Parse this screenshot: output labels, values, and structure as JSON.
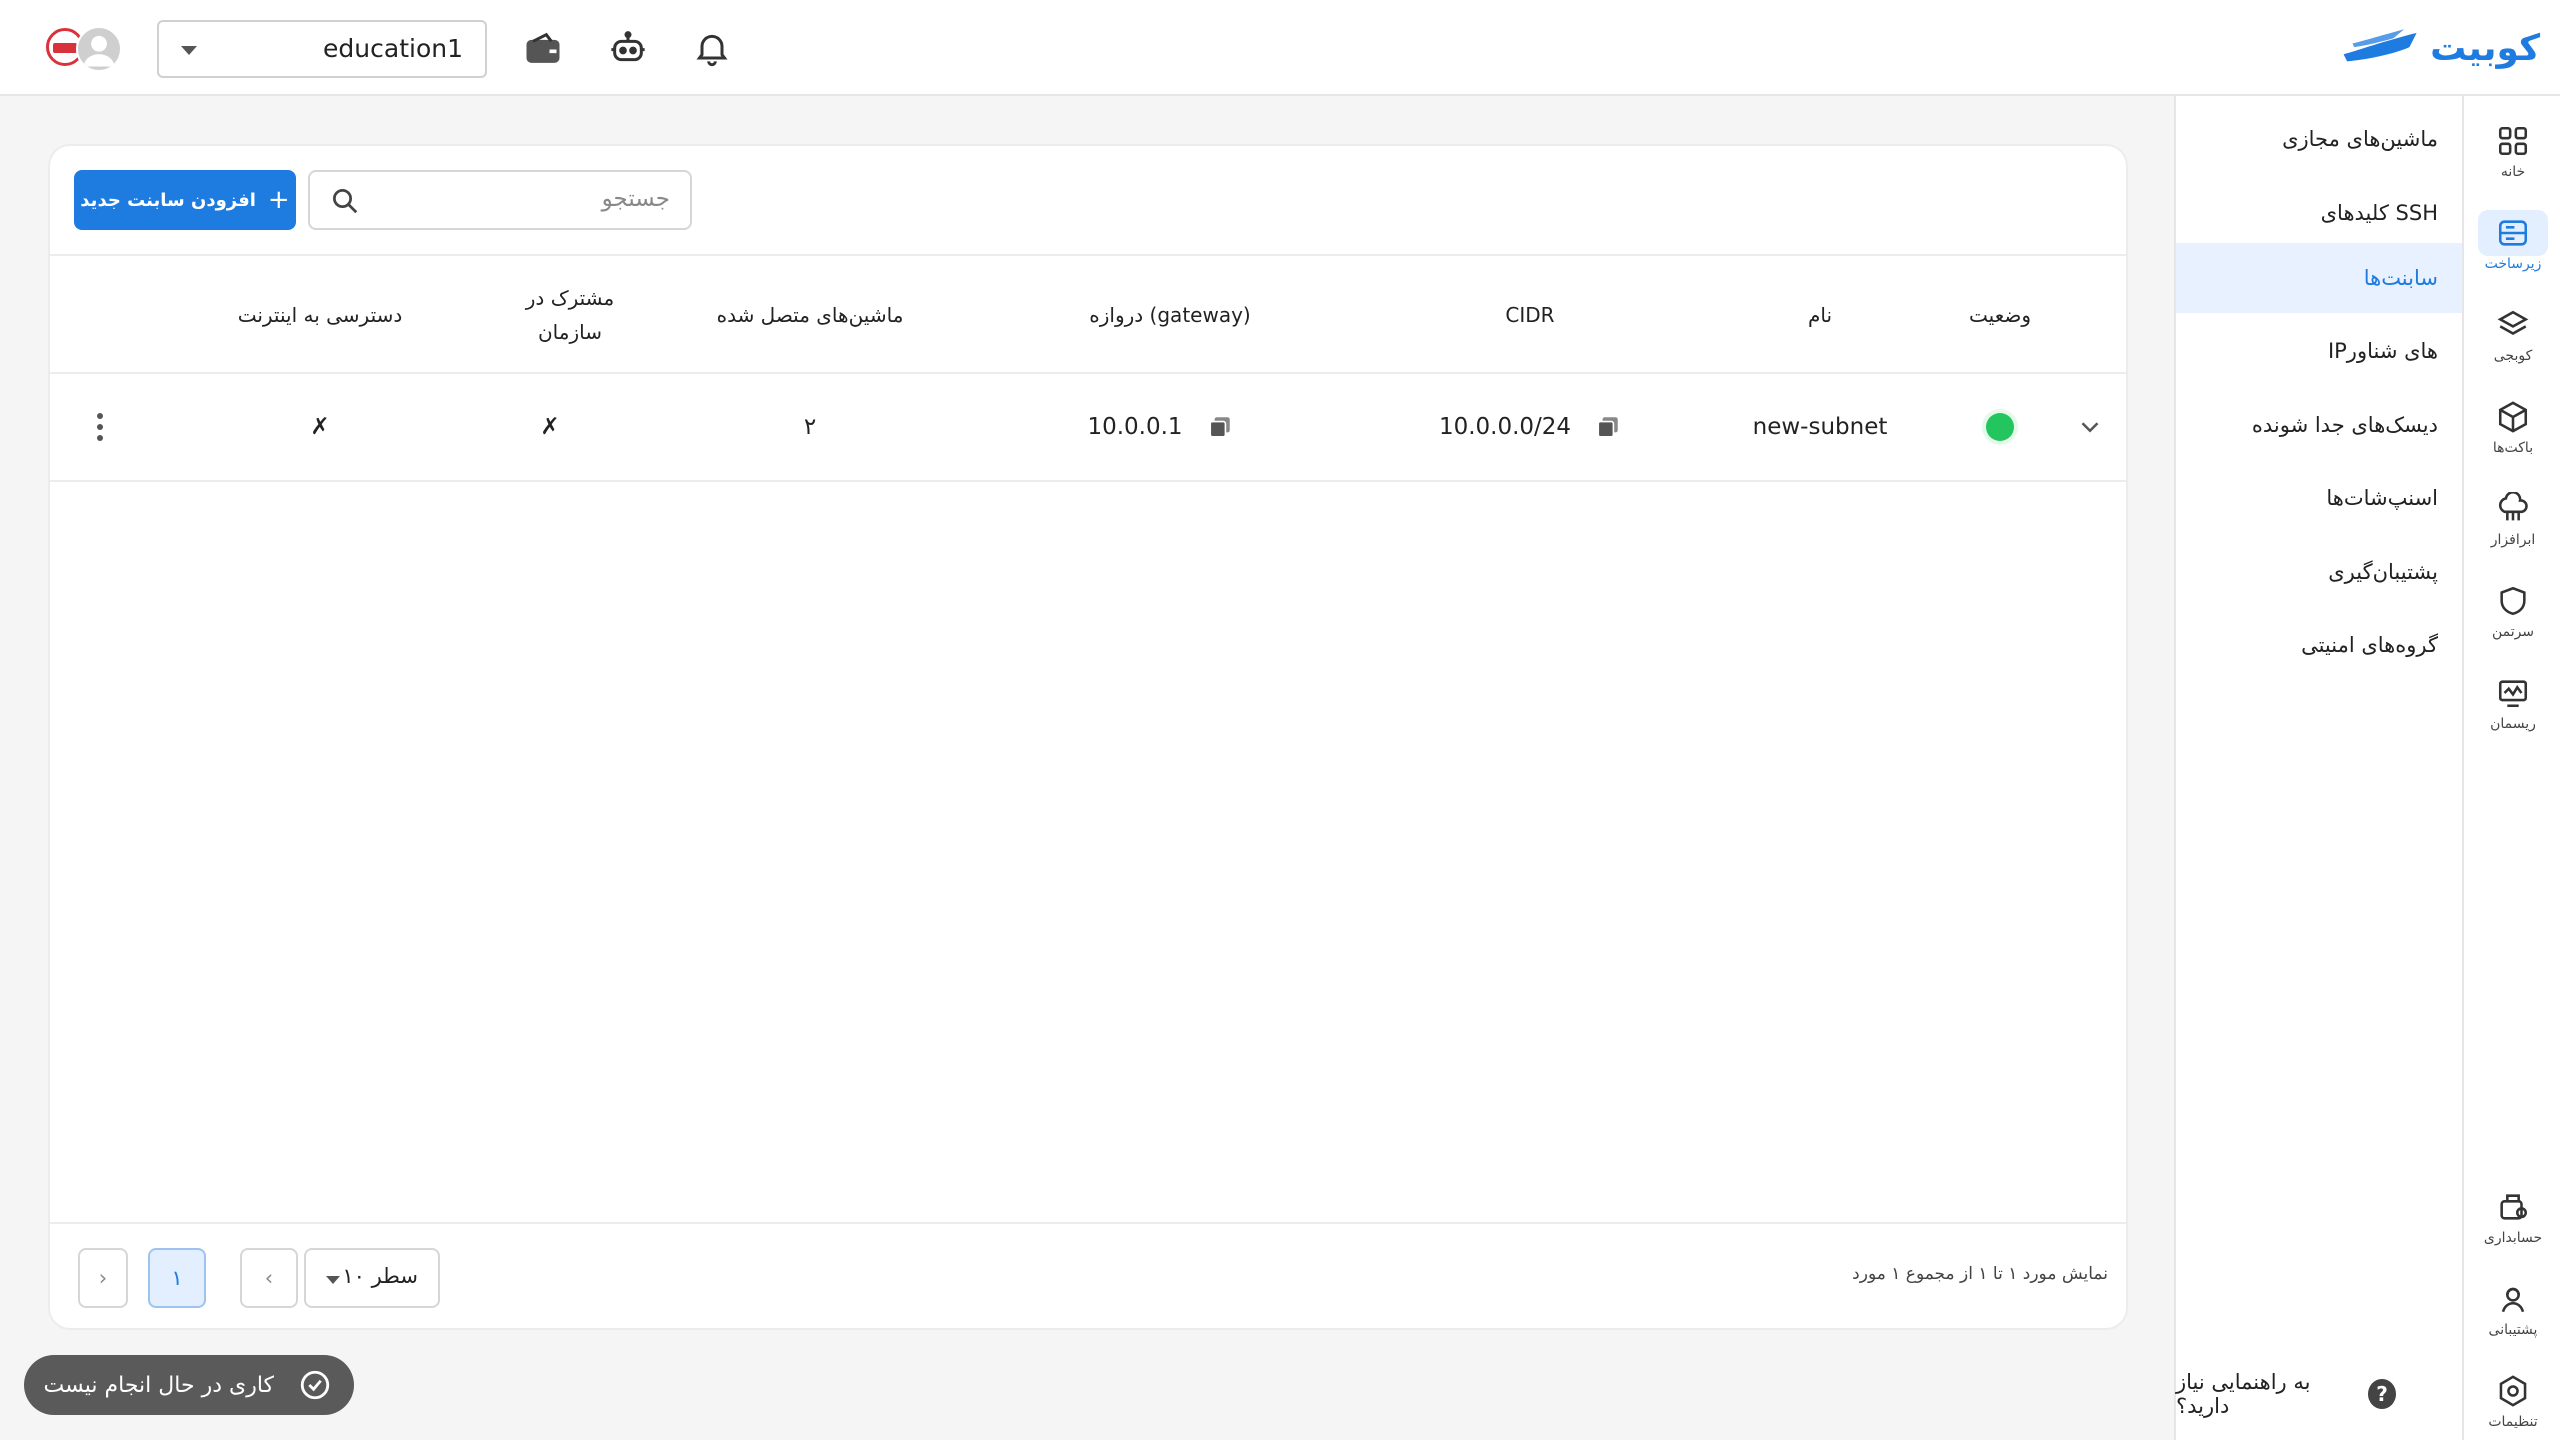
{
  "header": {
    "logo_text": "کوبیت",
    "org_selected": "education1",
    "icons": [
      "notification-bell-icon",
      "robot-icon",
      "wallet-icon"
    ]
  },
  "rail": {
    "items": [
      {
        "label": "خانه",
        "icon": "grid-icon"
      },
      {
        "label": "زیرساخت",
        "icon": "server-icon",
        "active": true
      },
      {
        "label": "کوبجی",
        "icon": "layers-icon"
      },
      {
        "label": "باکت‌ها",
        "icon": "cube-icon"
      },
      {
        "label": "ابرافزار",
        "icon": "cloud-app-icon"
      },
      {
        "label": "سرتمن",
        "icon": "shield-icon"
      },
      {
        "label": "ریسمان",
        "icon": "monitor-icon"
      },
      {
        "label": "حسابداری",
        "icon": "accounting-icon"
      },
      {
        "label": "پشتیبانی",
        "icon": "support-icon"
      },
      {
        "label": "تنظیمات",
        "icon": "settings-icon"
      }
    ]
  },
  "submenu": {
    "items": [
      {
        "label": "ماشین‌های مجازی"
      },
      {
        "label": "کلیدهای SSH"
      },
      {
        "label": "سابنت‌ها",
        "active": true
      },
      {
        "label": "IPهای شناور"
      },
      {
        "label": "دیسک‌های جدا شونده"
      },
      {
        "label": "اسنپ‌شات‌ها"
      },
      {
        "label": "پشتیبان‌گیری"
      },
      {
        "label": "گروه‌های امنیتی"
      }
    ],
    "help_text": "به راهنمایی نیاز دارید؟",
    "help_icon_char": "?"
  },
  "toolbar": {
    "add_label": "افزودن سابنت جدید",
    "add_plus": "+",
    "search_placeholder": "جستجو"
  },
  "table": {
    "headers": {
      "status": "وضعیت",
      "name": "نام",
      "cidr": "CIDR",
      "gateway": "دروازه (gateway)",
      "machines": "ماشین‌های متصل شده",
      "shared_line1": "مشترک در",
      "shared_line2": "سازمان",
      "internet": "دسترسی به اینترنت"
    },
    "rows": [
      {
        "status_color": "#22c55e",
        "name": "new-subnet",
        "cidr": "10.0.0.0/24",
        "gateway": "10.0.0.1",
        "machines": "۲",
        "shared": "✗",
        "internet": "✗"
      }
    ]
  },
  "footer": {
    "range_text": "نمایش مورد ۱ تا ۱ از مجموع ۱ مورد",
    "rows_per_page": "۱۰ سطر",
    "current_page": "۱",
    "prev_char": "‹",
    "next_char": "›"
  },
  "toast": {
    "text": "کاری در حال انجام نیست"
  },
  "colors": {
    "accent": "#1e7be0",
    "status_ok": "#22c55e",
    "toast_bg": "#5a5a5a"
  }
}
